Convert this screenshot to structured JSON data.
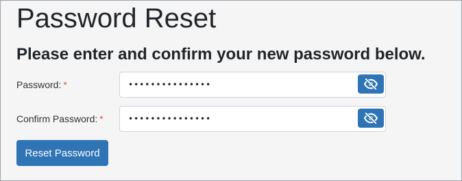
{
  "page": {
    "title": "Password Reset",
    "instructions": "Please enter and confirm your new password below."
  },
  "form": {
    "password": {
      "label": "Password:",
      "required_marker": "*",
      "value": "•••••••••••••••",
      "toggle_icon": "eye-slash-icon"
    },
    "confirm_password": {
      "label": "Confirm Password:",
      "required_marker": "*",
      "value": "•••••••••••••••",
      "toggle_icon": "eye-slash-icon"
    },
    "submit_label": "Reset Password"
  },
  "colors": {
    "accent": "#2f74b5",
    "required": "#d9534f",
    "background": "#f5f5f5"
  }
}
